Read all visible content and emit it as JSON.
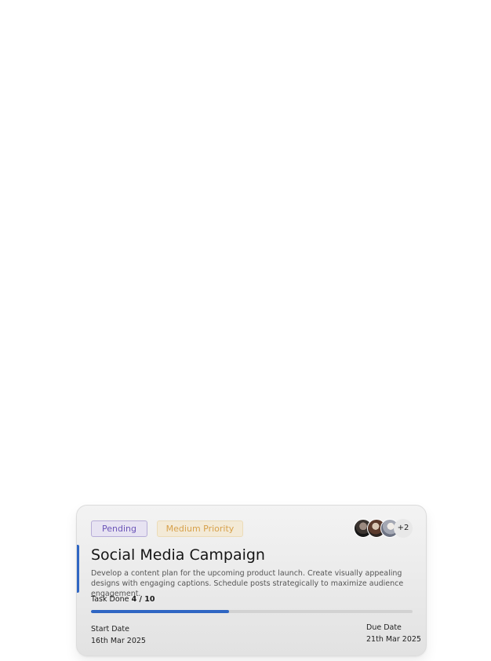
{
  "task_card": {
    "status_badge": "Pending",
    "priority_badge": "Medium Priority",
    "assignees_more": "+2",
    "title": "Social Media Campaign",
    "description": "Develop a content plan for the upcoming product launch. Create visually appealing designs with engaging captions. Schedule posts strategically to maximize audience engagement.",
    "task_done_label": "Task Done",
    "task_done_count": "4 / 10",
    "progress_fraction": 0.43,
    "start_date_label": "Start Date",
    "start_date": "16th Mar 2025",
    "due_date_label": "Due Date",
    "due_date": "21th Mar 2025",
    "colors": {
      "accent": "#2f66c3",
      "pending": "#6b54b8",
      "medium_priority": "#d7a14b"
    }
  }
}
